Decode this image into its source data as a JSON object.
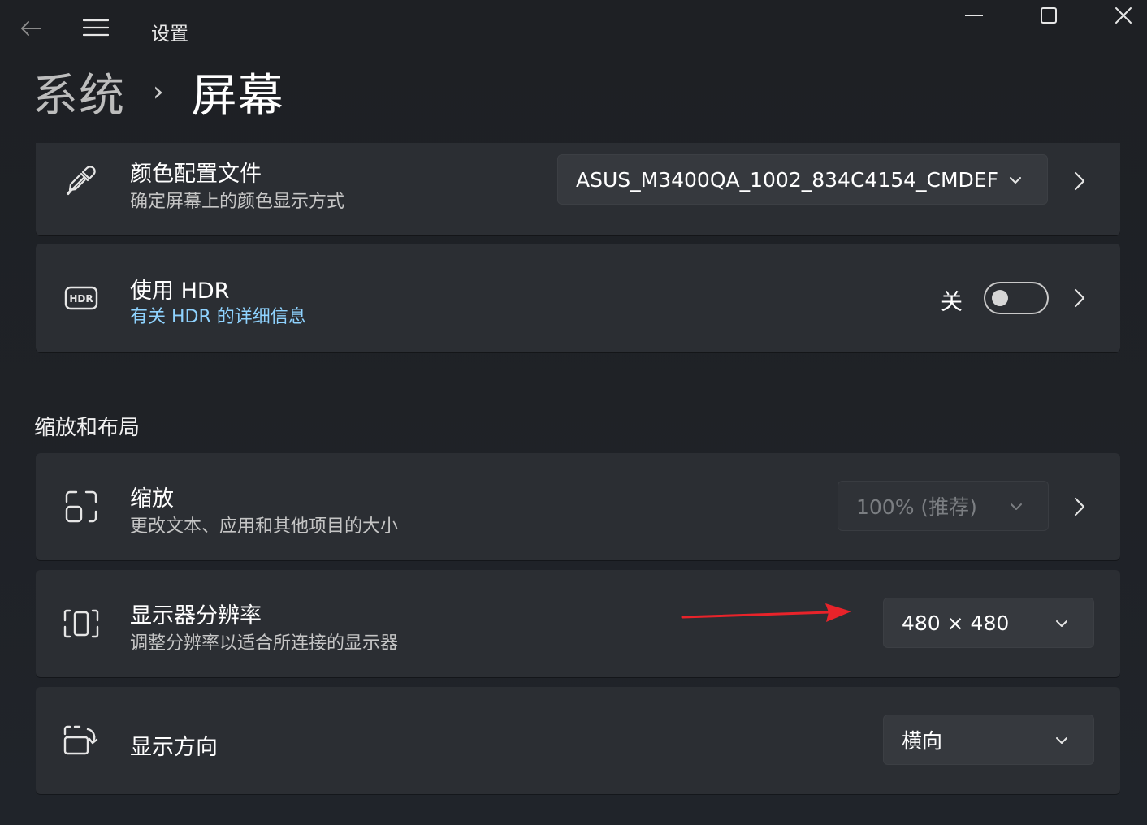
{
  "window": {
    "app_title": "设置",
    "icons": {
      "back": "back-arrow-icon",
      "menu": "hamburger-menu-icon",
      "minimize": "minimize-icon",
      "maximize": "maximize-icon",
      "close": "close-icon"
    }
  },
  "breadcrumb": {
    "parent": "系统",
    "separator": "›",
    "current": "屏幕"
  },
  "color_profile": {
    "icon": "eyedropper-icon",
    "title": "颜色配置文件",
    "subtitle": "确定屏幕上的颜色显示方式",
    "selected": "ASUS_M3400QA_1002_834C4154_CMDEF"
  },
  "hdr": {
    "icon": "hdr-icon",
    "title": "使用 HDR",
    "link": "有关 HDR 的详细信息",
    "toggle_label": "关",
    "toggle_on": false
  },
  "section": {
    "title": "缩放和布局"
  },
  "scale": {
    "icon": "scale-icon",
    "title": "缩放",
    "subtitle": "更改文本、应用和其他项目的大小",
    "selected": "100% (推荐)",
    "disabled": true
  },
  "resolution": {
    "icon": "resolution-icon",
    "title": "显示器分辨率",
    "subtitle": "调整分辨率以适合所连接的显示器",
    "selected": "480 × 480"
  },
  "orientation": {
    "icon": "rotate-screen-icon",
    "title": "显示方向",
    "selected": "横向"
  },
  "colors": {
    "background": "#202327",
    "card": "#2b2e33",
    "link": "#8fd3ff",
    "annotation_arrow": "#e8232a"
  }
}
